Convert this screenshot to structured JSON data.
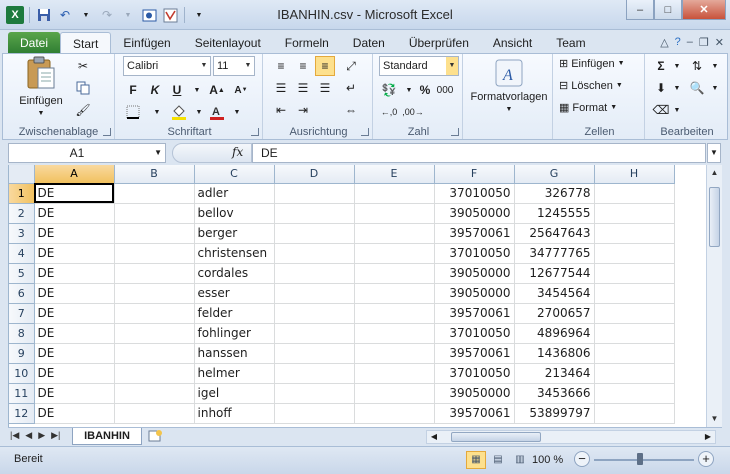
{
  "window": {
    "title": "IBANHIN.csv - Microsoft Excel",
    "minimize": "–",
    "maximize": "□",
    "close": "✕"
  },
  "tabs": [
    "Datei",
    "Start",
    "Einfügen",
    "Seitenlayout",
    "Formeln",
    "Daten",
    "Überprüfen",
    "Ansicht",
    "Team"
  ],
  "ribbon": {
    "clipboard": {
      "label": "Zwischenablage",
      "paste": "Einfügen"
    },
    "font": {
      "label": "Schriftart",
      "name": "Calibri",
      "size": "11",
      "bold": "F",
      "italic": "K",
      "underline": "U"
    },
    "alignment": {
      "label": "Ausrichtung"
    },
    "number": {
      "label": "Zahl",
      "format": "Standard"
    },
    "styles": {
      "label": "Formatvorlagen"
    },
    "cells": {
      "label": "Zellen",
      "insert": "Einfügen",
      "delete": "Löschen",
      "format": "Format"
    },
    "editing": {
      "label": "Bearbeiten"
    }
  },
  "formula_bar": {
    "name_box": "A1",
    "fx": "fx",
    "content": "DE"
  },
  "grid": {
    "columns": [
      "A",
      "B",
      "C",
      "D",
      "E",
      "F",
      "G",
      "H"
    ],
    "rows": [
      {
        "n": "1",
        "a": "DE",
        "c": "adler",
        "f": "37010050",
        "g": "326778"
      },
      {
        "n": "2",
        "a": "DE",
        "c": "bellov",
        "f": "39050000",
        "g": "1245555"
      },
      {
        "n": "3",
        "a": "DE",
        "c": "berger",
        "f": "39570061",
        "g": "25647643"
      },
      {
        "n": "4",
        "a": "DE",
        "c": "christensen",
        "f": "37010050",
        "g": "34777765"
      },
      {
        "n": "5",
        "a": "DE",
        "c": "cordales",
        "f": "39050000",
        "g": "12677544"
      },
      {
        "n": "6",
        "a": "DE",
        "c": "esser",
        "f": "39050000",
        "g": "3454564"
      },
      {
        "n": "7",
        "a": "DE",
        "c": "felder",
        "f": "39570061",
        "g": "2700657"
      },
      {
        "n": "8",
        "a": "DE",
        "c": "fohlinger",
        "f": "37010050",
        "g": "4896964"
      },
      {
        "n": "9",
        "a": "DE",
        "c": "hanssen",
        "f": "39570061",
        "g": "1436806"
      },
      {
        "n": "10",
        "a": "DE",
        "c": "helmer",
        "f": "37010050",
        "g": "213464"
      },
      {
        "n": "11",
        "a": "DE",
        "c": "igel",
        "f": "39050000",
        "g": "3453666"
      },
      {
        "n": "12",
        "a": "DE",
        "c": "inhoff",
        "f": "39570061",
        "g": "53899797"
      }
    ]
  },
  "sheet": {
    "name": "IBANHIN"
  },
  "status": {
    "ready": "Bereit",
    "zoom": "100 %"
  }
}
